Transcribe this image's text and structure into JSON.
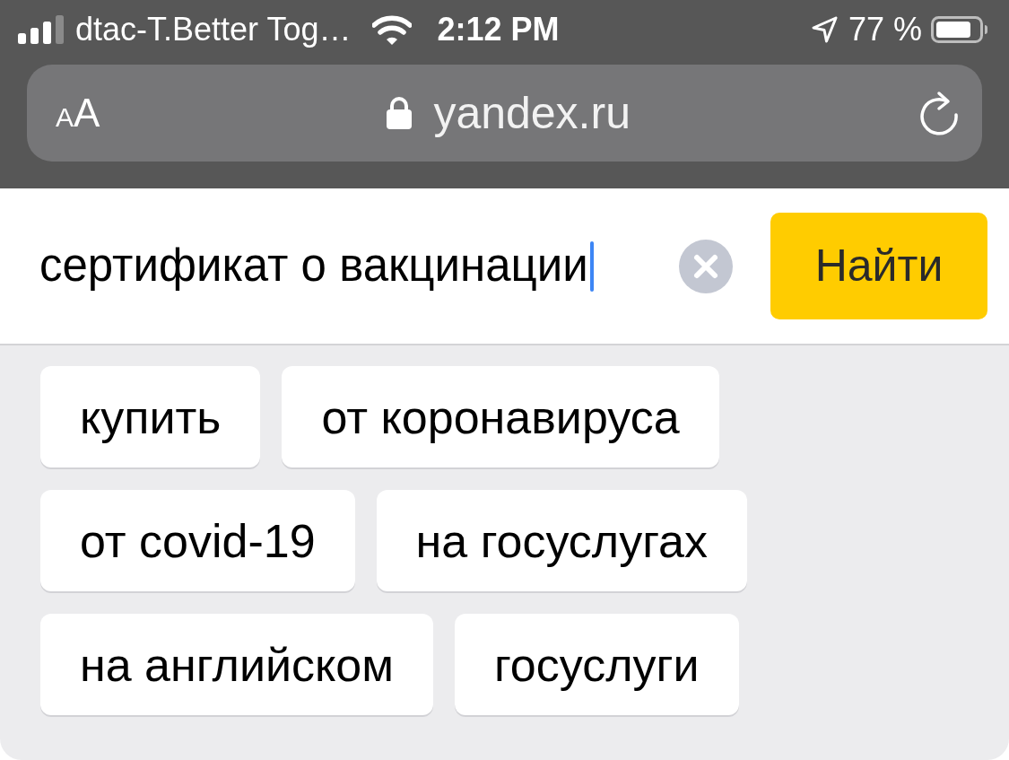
{
  "status_bar": {
    "carrier": "dtac-T.Better Tog…",
    "time": "2:12 PM",
    "battery": "77 %"
  },
  "address_bar": {
    "text_size_label": "AA",
    "url": "yandex.ru",
    "secure": true
  },
  "search": {
    "query": "сертификат о вакцинации",
    "focused": true,
    "button": "Найти"
  },
  "suggestions": [
    "купить",
    "от коронавируса",
    "от covid-19",
    "на госуслугах",
    "на английском",
    "госуслуги"
  ]
}
